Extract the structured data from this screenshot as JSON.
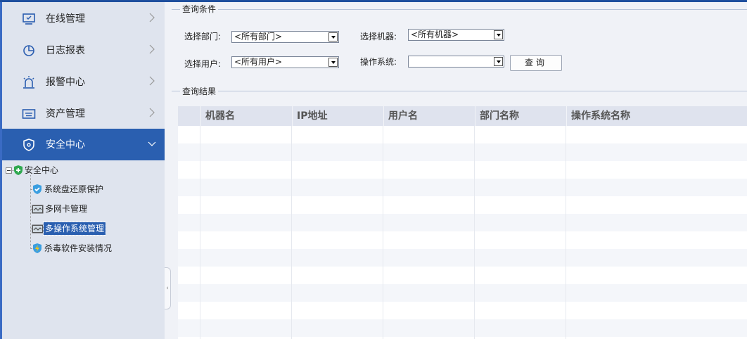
{
  "sidebar": {
    "nav": [
      {
        "label": "在线管理",
        "icon": "monitor-icon",
        "active": false
      },
      {
        "label": "日志报表",
        "icon": "pie-chart-icon",
        "active": false
      },
      {
        "label": "报警中心",
        "icon": "alarm-icon",
        "active": false
      },
      {
        "label": "资产管理",
        "icon": "keyboard-icon",
        "active": false
      },
      {
        "label": "安全中心",
        "icon": "shield-icon",
        "active": true
      }
    ],
    "tree": {
      "root": "安全中心",
      "children": [
        {
          "label": "系统盘还原保护",
          "icon": "shield-check-icon",
          "selected": false
        },
        {
          "label": "多网卡管理",
          "icon": "network-card-icon",
          "selected": false
        },
        {
          "label": "多操作系统管理",
          "icon": "network-card-icon",
          "selected": true
        },
        {
          "label": "杀毒软件安装情况",
          "icon": "antivirus-shield-icon",
          "selected": false
        }
      ]
    }
  },
  "query": {
    "section_title": "查询条件",
    "dept_label": "选择部门:",
    "dept_value": "<所有部门>",
    "machine_label": "选择机器:",
    "machine_value": "<所有机器>",
    "user_label": "选择用户:",
    "user_value": "<所有用户>",
    "os_label": "操作系统:",
    "os_value": "",
    "search_button": "查询"
  },
  "results": {
    "section_title": "查询结果",
    "columns": [
      "机器名",
      "IP地址",
      "用户名",
      "部门名称",
      "操作系统名称"
    ],
    "rows": []
  },
  "colors": {
    "accent": "#2a5fb0",
    "sidebar_bg": "#dfe4ee",
    "header_bg": "#dfe3ee"
  }
}
